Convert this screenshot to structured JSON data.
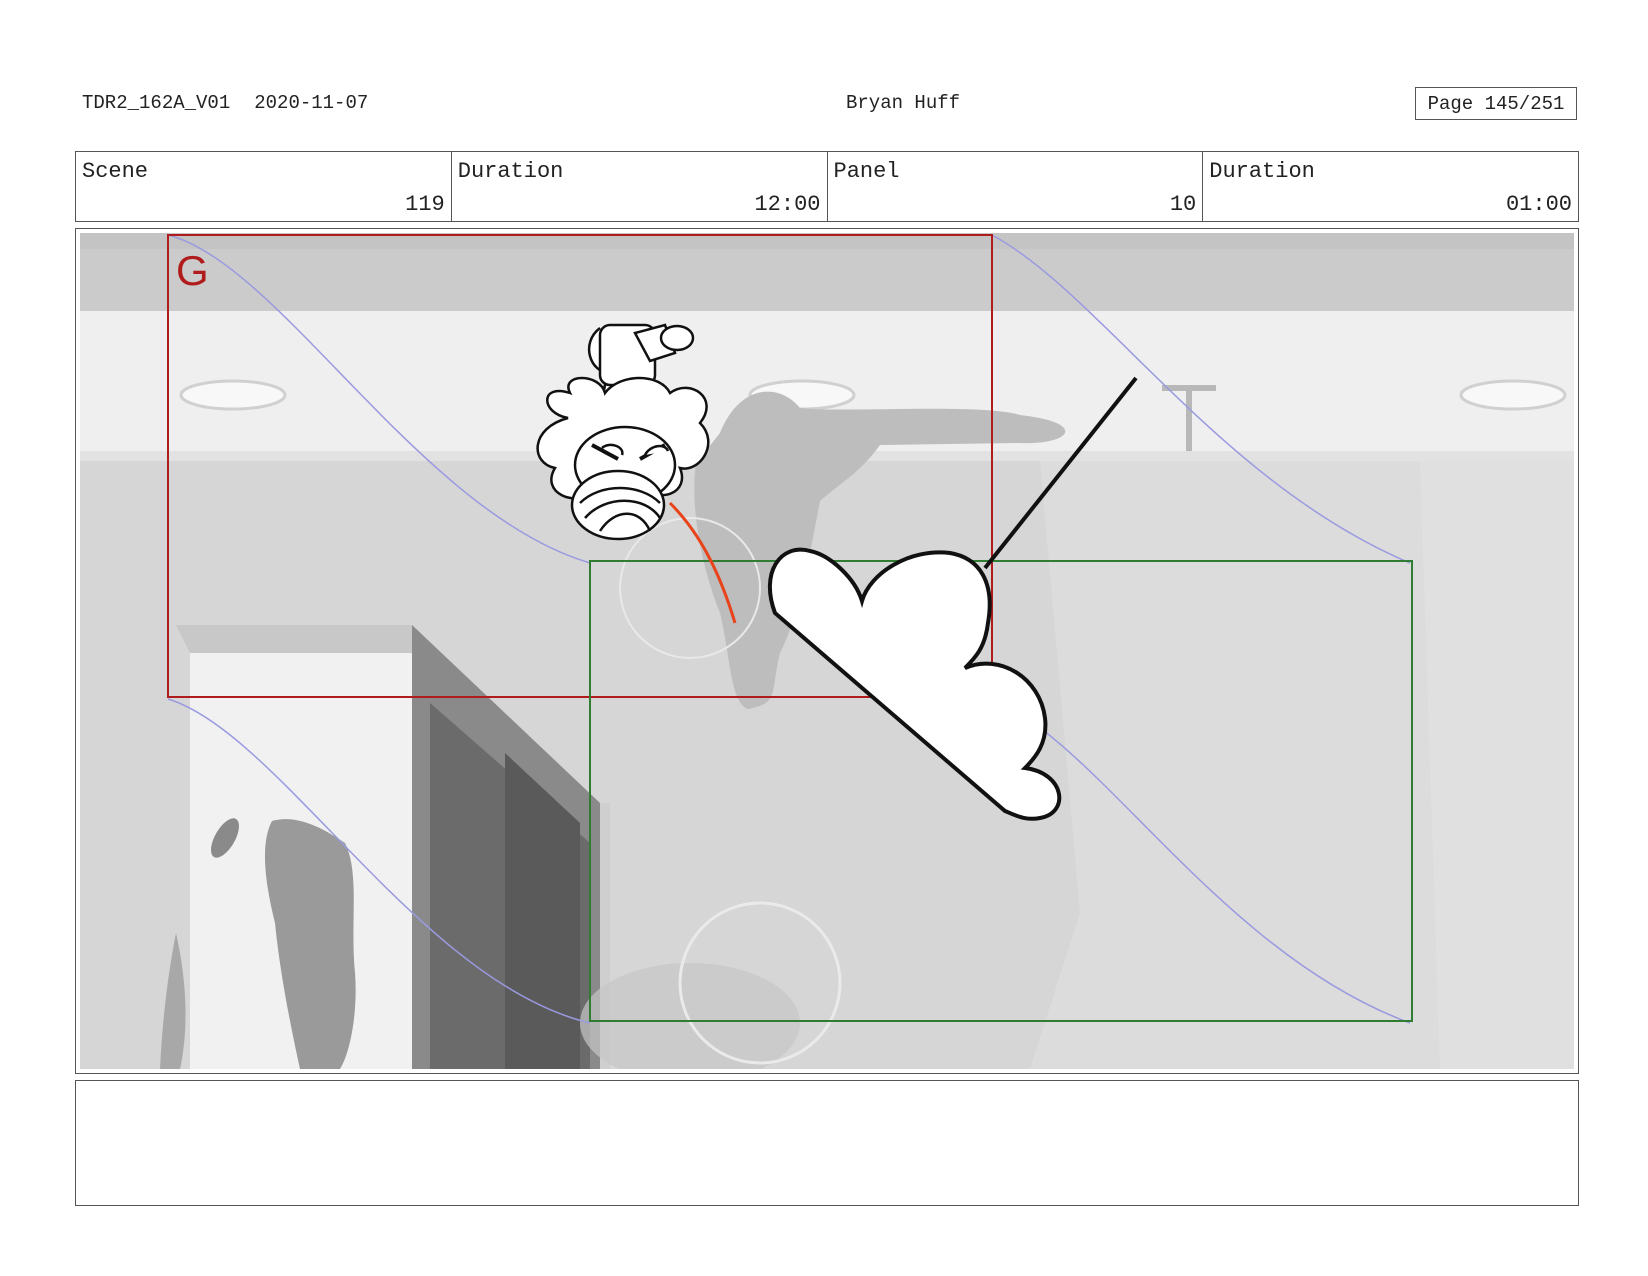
{
  "header": {
    "file_name": "TDR2_162A_V01",
    "date": "2020-11-07",
    "artist": "Bryan Huff",
    "page": "Page 145/251"
  },
  "info": {
    "scene_label": "Scene",
    "scene_value": "119",
    "scene_duration_label": "Duration",
    "scene_duration_value": "12:00",
    "panel_label": "Panel",
    "panel_value": "10",
    "panel_duration_label": "Duration",
    "panel_duration_value": "01:00"
  },
  "panel": {
    "camera_start_label": "G",
    "colors": {
      "camera_start": "#b01c1c",
      "camera_end": "#2e7d32",
      "motion_path": "#9a9ae0",
      "effect_stroke": "#e8431a"
    }
  },
  "notes": {
    "text": ""
  }
}
